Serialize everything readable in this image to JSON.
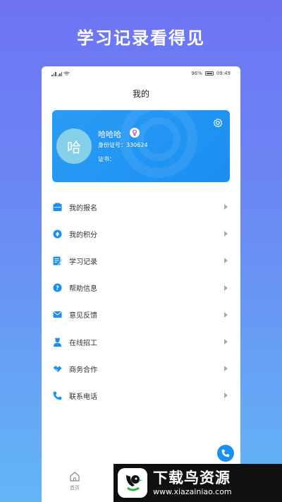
{
  "promo_title": "学习记录看得见",
  "status_bar": {
    "left_text": "46 ⁴⁶ᵢₗ",
    "battery_percent": "96%",
    "time": "09:49"
  },
  "page_title": "我的",
  "profile": {
    "avatar_text": "哈",
    "name": "哈哈哈",
    "id_line": "身份证号：330624",
    "cert_line": "证书："
  },
  "menu": [
    {
      "label": "我的报名",
      "icon": "registration-icon",
      "color": "#1b8ff2"
    },
    {
      "label": "我的积分",
      "icon": "points-icon",
      "color": "#1b8ff2"
    },
    {
      "label": "学习记录",
      "icon": "study-record-icon",
      "color": "#1b8ff2"
    },
    {
      "label": "帮助信息",
      "icon": "help-icon",
      "color": "#1b8ff2"
    },
    {
      "label": "意见反馈",
      "icon": "feedback-icon",
      "color": "#1b8ff2"
    },
    {
      "label": "在线招工",
      "icon": "recruit-icon",
      "color": "#1b8ff2"
    },
    {
      "label": "商务合作",
      "icon": "handshake-icon",
      "color": "#1b8ff2"
    },
    {
      "label": "联系电话",
      "icon": "phone-icon",
      "color": "#1b8ff2"
    }
  ],
  "tabbar": {
    "home_label": "首页"
  },
  "watermark": {
    "brand": "下载鸟资源",
    "url": "www.xiazainiao.com"
  },
  "colors": {
    "accent": "#1b8ff2",
    "gender_female": "#c040c0"
  }
}
